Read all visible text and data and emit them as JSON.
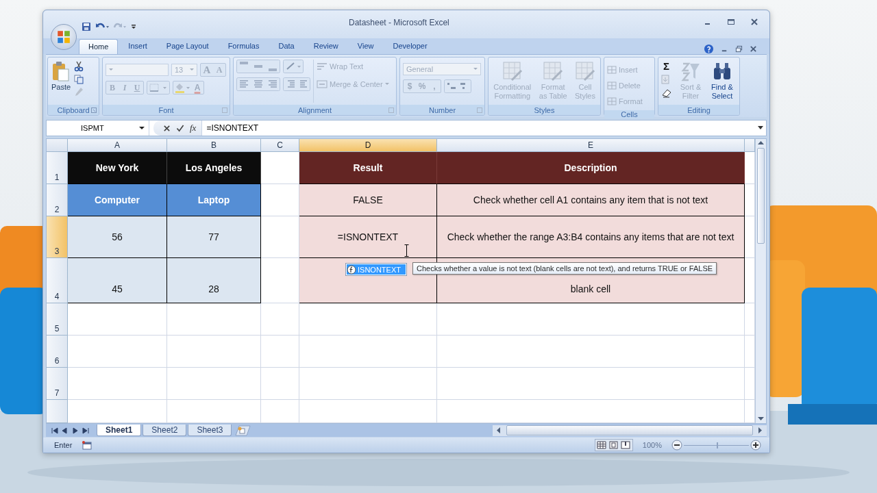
{
  "window": {
    "title": "Datasheet - Microsoft Excel"
  },
  "ribbon_tabs": [
    {
      "label": "Home",
      "selected": true
    },
    {
      "label": "Insert",
      "selected": false
    },
    {
      "label": "Page Layout",
      "selected": false
    },
    {
      "label": "Formulas",
      "selected": false
    },
    {
      "label": "Data",
      "selected": false
    },
    {
      "label": "Review",
      "selected": false
    },
    {
      "label": "View",
      "selected": false
    },
    {
      "label": "Developer",
      "selected": false
    }
  ],
  "ribbon": {
    "clipboard": {
      "label": "Clipboard",
      "paste": {
        "label": "Paste",
        "disabled": false
      }
    },
    "font": {
      "label": "Font",
      "disabled": true,
      "size": "13",
      "grow": "A",
      "shrink": "A",
      "styles": [
        "B",
        "I",
        "U"
      ],
      "color_label": "A"
    },
    "alignment": {
      "label": "Alignment",
      "wrap_text": {
        "label": "Wrap Text",
        "disabled": true
      },
      "merge": {
        "label": "Merge & Center",
        "disabled": true
      }
    },
    "number": {
      "label": "Number",
      "disabled": true,
      "format": "General",
      "symbols": [
        "$",
        "%",
        ","
      ]
    },
    "styles": {
      "label": "Styles",
      "items": [
        {
          "label": "Conditional Formatting",
          "disabled": true
        },
        {
          "label": "Format as Table",
          "disabled": true
        },
        {
          "label": "Cell Styles",
          "disabled": true
        }
      ]
    },
    "cells": {
      "label": "Cells",
      "items": [
        {
          "label": "Insert",
          "disabled": true
        },
        {
          "label": "Delete",
          "disabled": true
        },
        {
          "label": "Format",
          "disabled": true
        }
      ]
    },
    "editing": {
      "label": "Editing",
      "sum": "Σ",
      "items": [
        {
          "label": "Sort & Filter",
          "disabled": true
        },
        {
          "label": "Find & Select",
          "disabled": false
        }
      ]
    }
  },
  "formula_bar": {
    "name_box": "ISPMT",
    "function_label": "fx",
    "formula": "=ISNONTEXT"
  },
  "columns": [
    {
      "label": "A",
      "selected": false
    },
    {
      "label": "B",
      "selected": false
    },
    {
      "label": "C",
      "selected": false
    },
    {
      "label": "D",
      "selected": true
    },
    {
      "label": "E",
      "selected": false
    }
  ],
  "rows": [
    {
      "label": "1",
      "selected": false,
      "cells": [
        {
          "kind": "black",
          "text": "New York"
        },
        {
          "kind": "black",
          "text": "Los Angeles"
        },
        {
          "kind": "empty"
        },
        {
          "kind": "maroon",
          "text": "Result"
        },
        {
          "kind": "maroon",
          "text": "Description"
        }
      ]
    },
    {
      "label": "2",
      "selected": false,
      "cells": [
        {
          "kind": "blue",
          "text": "Computer"
        },
        {
          "kind": "blue",
          "text": "Laptop"
        },
        {
          "kind": "empty"
        },
        {
          "kind": "pink",
          "text": "FALSE"
        },
        {
          "kind": "pink",
          "text": "Check whether cell A1 contains any item that is not text"
        }
      ]
    },
    {
      "label": "3",
      "selected": true,
      "cells": [
        {
          "kind": "grey",
          "text": "56"
        },
        {
          "kind": "grey",
          "text": "77"
        },
        {
          "kind": "empty"
        },
        {
          "kind": "pink",
          "text": "=ISNONTEXT"
        },
        {
          "kind": "pink",
          "text": "Check whether the range A3:B4 contains any items that are not text"
        }
      ]
    },
    {
      "label": "4",
      "selected": false,
      "cells": [
        {
          "kind": "grey",
          "text": "45"
        },
        {
          "kind": "grey",
          "text": "28"
        },
        {
          "kind": "empty"
        },
        {
          "kind": "pink"
        },
        {
          "kind": "pink",
          "text": "blank cell"
        }
      ]
    },
    {
      "label": "5",
      "selected": false
    },
    {
      "label": "6",
      "selected": false
    },
    {
      "label": "7",
      "selected": false
    }
  ],
  "autocomplete": [
    {
      "label": "ISNONTEXT",
      "selected": true
    }
  ],
  "tooltip": "Checks whether a value is not text (blank cells are not text), and returns TRUE or FALSE",
  "sheet_tabs": [
    {
      "label": "Sheet1",
      "selected": true
    },
    {
      "label": "Sheet2",
      "selected": false
    },
    {
      "label": "Sheet3",
      "selected": false
    }
  ],
  "status_bar": {
    "mode": "Enter",
    "zoom": "100%",
    "zoom_slider": {
      "level": 0.5
    }
  }
}
